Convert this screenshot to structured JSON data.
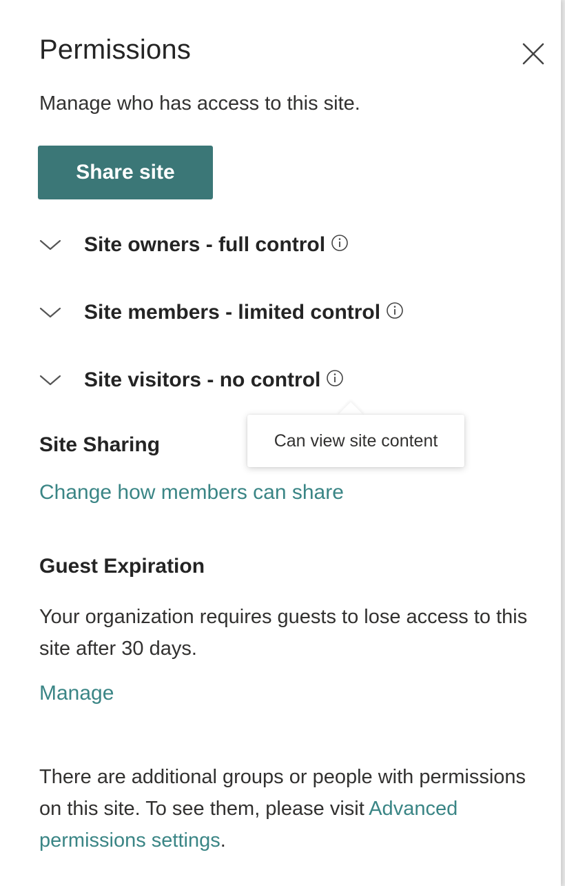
{
  "panel": {
    "title": "Permissions",
    "subtitle": "Manage who has access to this site.",
    "close_icon": "close-icon",
    "share_button_label": "Share site"
  },
  "groups": [
    {
      "label": "Site owners - full control",
      "icon": "info-icon"
    },
    {
      "label": "Site members - limited control",
      "icon": "info-icon"
    },
    {
      "label": "Site visitors - no control",
      "icon": "info-icon"
    }
  ],
  "tooltip": {
    "text": "Can view site content"
  },
  "site_sharing": {
    "heading": "Site Sharing",
    "link_label": "Change how members can share"
  },
  "guest_expiration": {
    "heading": "Guest Expiration",
    "description": "Your organization requires guests to lose access to this site after 30 days.",
    "manage_label": "Manage"
  },
  "additional": {
    "text_before": "There are additional groups or people with permissions on this site. To see them, please visit ",
    "link_label": "Advanced permissions settings",
    "text_after": "."
  },
  "colors": {
    "accent": "#3b7777",
    "link": "#3a8585",
    "text": "#242424"
  }
}
